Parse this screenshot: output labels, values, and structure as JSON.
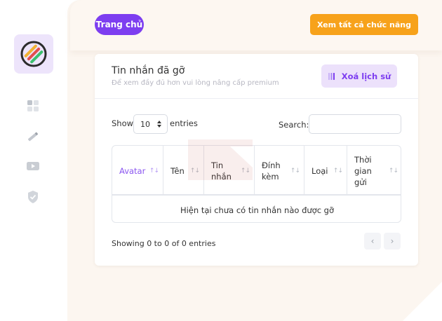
{
  "header": {
    "home_button": "Trang chủ",
    "all_features_button": "Xem tất cả chức năng"
  },
  "sidebar": {
    "icons": [
      "logo-icon",
      "dashboard-icon",
      "pen-icon",
      "video-icon",
      "shield-check-icon"
    ]
  },
  "card": {
    "title": "Tin nhắn đã gỡ",
    "subtitle": "Để xem đầy đủ hơn vui lòng nâng cấp premium",
    "clear_button": "Xoá lịch sử"
  },
  "table_controls": {
    "show_label": "Show",
    "entries_value": "10",
    "entries_label": "entries",
    "search_label": "Search:",
    "search_value": ""
  },
  "table": {
    "columns": [
      {
        "line1": "Avatar",
        "line2": "",
        "line3": ""
      },
      {
        "line1": "Tên",
        "line2": "",
        "line3": ""
      },
      {
        "line1": "Tin",
        "line2": "nhắn",
        "line3": ""
      },
      {
        "line1": "Đính",
        "line2": "kèm",
        "line3": ""
      },
      {
        "line1": "Loại",
        "line2": "",
        "line3": ""
      },
      {
        "line1": "Thời",
        "line2": "gian",
        "line3": "gửi"
      }
    ],
    "empty_message": "Hiện tại chưa có tin nhắn nào được gỡ"
  },
  "footer": {
    "showing_text": "Showing 0 to 0 of 0 entries",
    "prev_symbol": "‹",
    "next_symbol": "›"
  },
  "colors": {
    "primary_purple": "#7d3ef0",
    "accent_orange": "#f7a21b",
    "light_purple": "#ece1fb",
    "background_cream": "#fcf6f0"
  }
}
